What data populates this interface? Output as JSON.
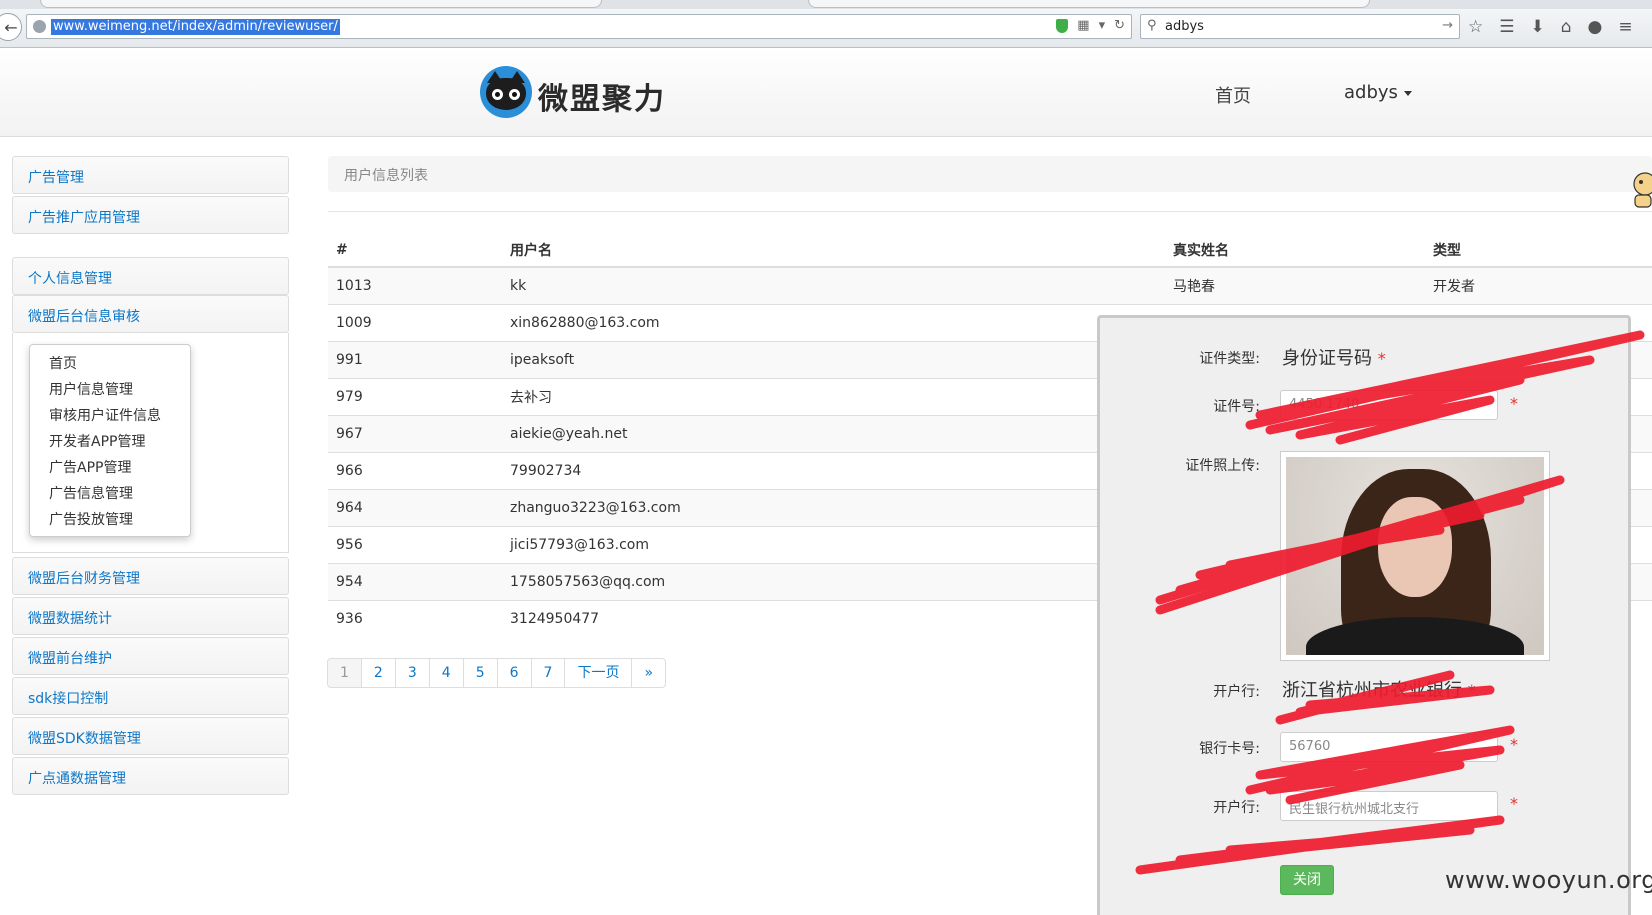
{
  "browser": {
    "url": "www.weimeng.net/index/admin/reviewuser/",
    "search_text": "adbys"
  },
  "header": {
    "logo_text": "微盟聚力",
    "nav_home": "首页",
    "nav_user": "adbys"
  },
  "sidebar": {
    "items": [
      "广告管理",
      "广告推广应用管理",
      "个人信息管理",
      "微盟后台信息审核",
      "微盟后台财务管理",
      "微盟数据统计",
      "微盟前台维护",
      "sdk接口控制",
      "微盟SDK数据管理",
      "广点通数据管理"
    ],
    "submenu": [
      "首页",
      "用户信息管理",
      "审核用户证件信息",
      "开发者APP管理",
      "广告APP管理",
      "广告信息管理",
      "广告投放管理"
    ]
  },
  "main": {
    "breadcrumb": "用户信息列表",
    "table": {
      "headers": [
        "#",
        "用户名",
        "真实姓名",
        "类型"
      ],
      "rows": [
        [
          "1013",
          "kk",
          "马艳春",
          "开发者"
        ],
        [
          "1009",
          "xin862880@163.com",
          "",
          ""
        ],
        [
          "991",
          "ipeaksoft",
          "",
          ""
        ],
        [
          "979",
          "去补习",
          "",
          ""
        ],
        [
          "967",
          "aiekie@yeah.net",
          "",
          ""
        ],
        [
          "966",
          "79902734",
          "",
          ""
        ],
        [
          "964",
          "zhanguo3223@163.com",
          "",
          ""
        ],
        [
          "956",
          "jici57793@163.com",
          "",
          ""
        ],
        [
          "954",
          "1758057563@qq.com",
          "",
          ""
        ],
        [
          "936",
          "3124950477",
          "",
          ""
        ]
      ]
    },
    "pagination": [
      "1",
      "2",
      "3",
      "4",
      "5",
      "6",
      "7",
      "下一页",
      "»"
    ]
  },
  "modal": {
    "cert_type_label": "证件类型:",
    "cert_type_value": "身份证号码",
    "cert_no_label": "证件号:",
    "cert_no_value": "4450                1740",
    "cert_photo_label": "证件照上传:",
    "bank_label": "开户行:",
    "bank_value": "浙江省杭州市农业银行",
    "card_label": "银行卡号:",
    "card_value": "               56760",
    "branch_label": "开户行:",
    "branch_value": "民生银行杭州城北支行",
    "required_mark": "*",
    "close_label": "关闭"
  },
  "watermark": "www.wooyun.org",
  "colors": {
    "link_blue": "#0d77c7",
    "scribble_red": "#ee1c2e",
    "close_green": "#5cb85c"
  }
}
